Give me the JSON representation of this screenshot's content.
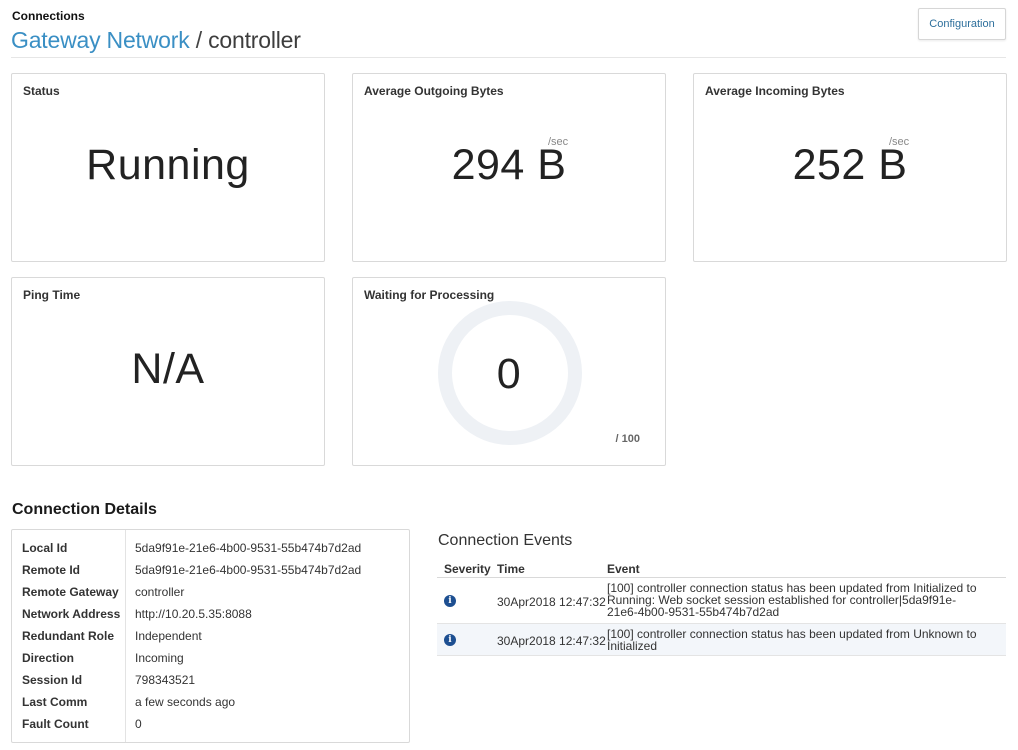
{
  "header": {
    "section_label": "Connections",
    "breadcrumb_link": "Gateway Network",
    "breadcrumb_sep": " / ",
    "breadcrumb_current": "controller",
    "config_button": "Configuration"
  },
  "cards": {
    "status": {
      "title": "Status",
      "value": "Running"
    },
    "outgoing": {
      "title": "Average Outgoing Bytes",
      "value": "294 B",
      "unit": "/sec"
    },
    "incoming": {
      "title": "Average Incoming Bytes",
      "value": "252 B",
      "unit": "/sec"
    },
    "ping": {
      "title": "Ping Time",
      "value": "N/A"
    },
    "waiting": {
      "title": "Waiting for Processing",
      "value": "0",
      "max": "/ 100",
      "fill_fraction": 0
    }
  },
  "details": {
    "heading": "Connection Details",
    "rows": [
      {
        "key": "Local Id",
        "value": "5da9f91e-21e6-4b00-9531-55b474b7d2ad"
      },
      {
        "key": "Remote Id",
        "value": "5da9f91e-21e6-4b00-9531-55b474b7d2ad"
      },
      {
        "key": "Remote Gateway",
        "value": "controller"
      },
      {
        "key": "Network Address",
        "value": "http://10.20.5.35:8088"
      },
      {
        "key": "Redundant Role",
        "value": "Independent"
      },
      {
        "key": "Direction",
        "value": "Incoming"
      },
      {
        "key": "Session Id",
        "value": "798343521"
      },
      {
        "key": "Last Comm",
        "value": "a few seconds ago"
      },
      {
        "key": "Fault Count",
        "value": "0"
      }
    ]
  },
  "events": {
    "heading": "Connection Events",
    "columns": {
      "severity": "Severity",
      "time": "Time",
      "event": "Event"
    },
    "rows": [
      {
        "severity_icon": "info-icon",
        "severity_glyph": "i",
        "time": "30Apr2018 12:47:32",
        "event": "[100] controller connection status has been updated from Initialized to Running: Web socket session established for controller|5da9f91e-21e6-4b00-9531-55b474b7d2ad"
      },
      {
        "severity_icon": "info-icon",
        "severity_glyph": "i",
        "time": "30Apr2018 12:47:32",
        "event": "[100] controller connection status has been updated from Unknown to Initialized"
      }
    ]
  },
  "colors": {
    "link": "#3a8fc4",
    "info_icon": "#1d4f91",
    "gauge_track": "#eef1f5",
    "row_alt": "#f3f6fa"
  }
}
